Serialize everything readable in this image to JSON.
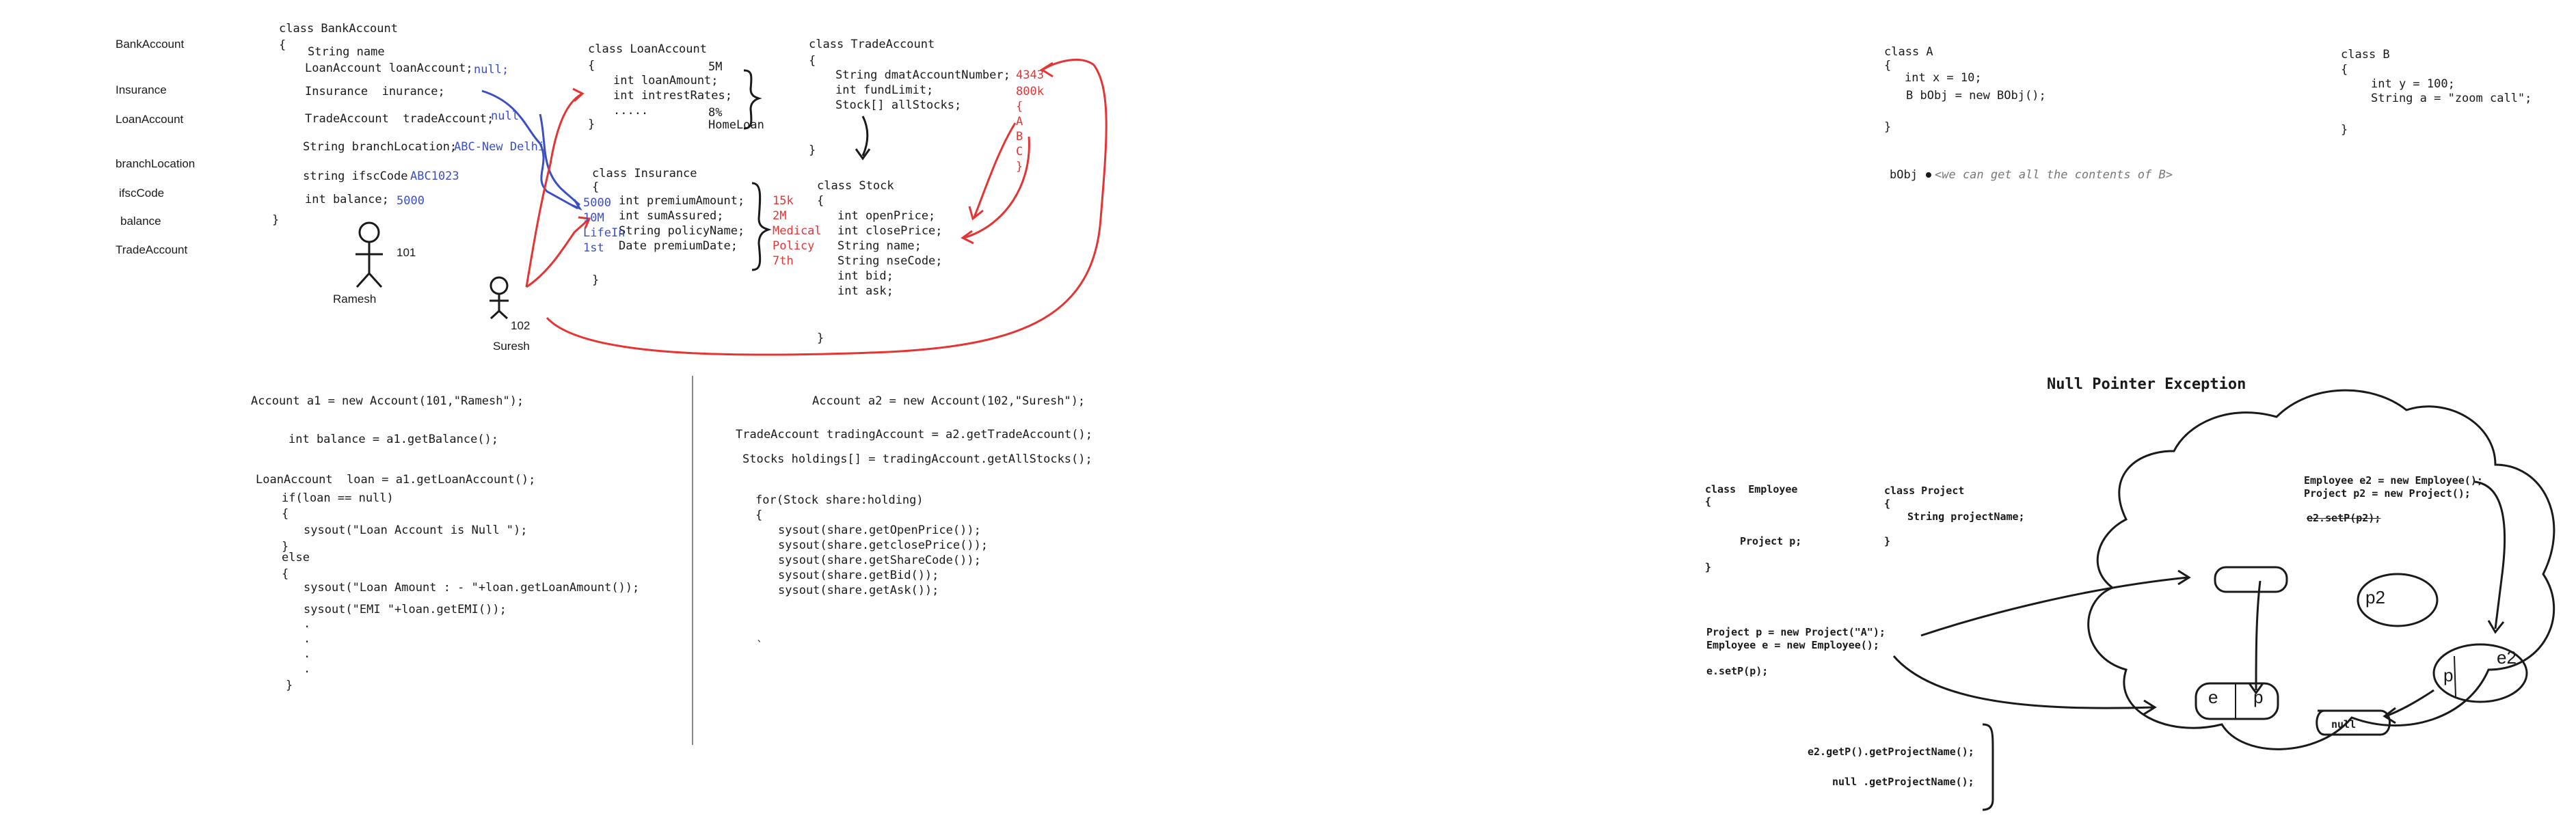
{
  "left_labels": [
    "BankAccount",
    "Insurance",
    "LoanAccount",
    "branchLocation",
    "ifscCode",
    "balance",
    "TradeAccount"
  ],
  "bank_account": {
    "header": "class BankAccount",
    "open_brace": "{",
    "lines": [
      "String name",
      "LoanAccount loanAccount;",
      "Insurance  inurance;",
      "TradeAccount  tradeAccount;",
      "String branchLocation;",
      "string ifscCode",
      "int balance;"
    ],
    "values": {
      "loan": "null;",
      "trade": "null",
      "branch": "ABC-New Delhi",
      "ifsc": "ABC1023",
      "balance": "5000"
    },
    "close_brace": "}"
  },
  "people": [
    {
      "name": "Ramesh",
      "id": "101"
    },
    {
      "name": "Suresh",
      "id": "102"
    }
  ],
  "loan_account": {
    "header": "class LoanAccount",
    "lines": [
      "{",
      "int loanAmount;",
      "int intrestRates;",
      ".....",
      "}"
    ],
    "annotations": [
      "5M",
      "8%",
      "HomeLoan"
    ]
  },
  "insurance": {
    "header": "class Insurance",
    "lines": [
      "{",
      "int premiumAmount;",
      "int sumAssured;",
      "String policyName;",
      "Date premiumDate;",
      "}"
    ],
    "left_values": [
      "5000",
      "10M",
      "LifeIn",
      "1st"
    ],
    "right_values": [
      "15k",
      "2M",
      "Medical",
      "Policy",
      "7th"
    ]
  },
  "trade_account": {
    "header": "class TradeAccount",
    "lines": [
      "{",
      "String dmatAccountNumber;",
      "int fundLimit;",
      "Stock[] allStocks;",
      "}"
    ],
    "values": [
      "4343",
      "800k",
      "{",
      "A",
      "B",
      "C",
      "}"
    ]
  },
  "stock": {
    "header": "class Stock",
    "lines": [
      "{",
      "int openPrice;",
      "int closePrice;",
      "String name;",
      "String nseCode;",
      "int bid;",
      "int ask;",
      "}"
    ]
  },
  "code_a1": [
    "Account a1 = new Account(101,\"Ramesh\");",
    "int balance = a1.getBalance();",
    "LoanAccount  loan = a1.getLoanAccount();",
    "if(loan == null)",
    "{",
    "sysout(\"Loan Account is Null \");",
    "}",
    "else",
    "{",
    "sysout(\"Loan Amount : - \"+loan.getLoanAmount());",
    "sysout(\"EMI \"+loan.getEMI());",
    ".",
    ".",
    ".",
    ".",
    "}"
  ],
  "code_a2": [
    "Account a2 = new Account(102,\"Suresh\");",
    "TradeAccount tradingAccount = a2.getTradeAccount();",
    "Stocks holdings[] = tradingAccount.getAllStocks();",
    "for(Stock share:holding)",
    "{",
    "sysout(share.getOpenPrice());",
    "sysout(share.getclosePrice());",
    "sysout(share.getShareCode());",
    "sysout(share.getBid());",
    "sysout(share.getAsk());",
    "`"
  ],
  "class_a": {
    "lines": [
      "class A",
      "{",
      "int x = 10;",
      "B bObj = new BObj();",
      "}"
    ]
  },
  "class_b": {
    "lines": [
      "class B",
      "{",
      "int y = 100;",
      "String a = \"zoom call\";",
      "}"
    ]
  },
  "bobj_note": {
    "label": "bObj",
    "comment": "<we can get all the contents of B>"
  },
  "npe": {
    "title": "Null Pointer Exception",
    "employee": [
      "class  Employee",
      "{",
      "Project p;",
      "}"
    ],
    "project": [
      "class Project",
      "{",
      "String projectName;",
      "}"
    ],
    "code_left": [
      "Project p = new Project(\"A\");",
      "Employee e = new Employee();",
      "e.setP(p);"
    ],
    "code_right": [
      "Employee e2 = new Employee();",
      "Project p2 = new Project();",
      "e2.setP(p2);"
    ],
    "calls": [
      "e2.getP().getProjectName();",
      "null .getProjectName();"
    ],
    "heap_labels": {
      "p2": "p2",
      "e": "e",
      "p": "p",
      "p_right": "p",
      "e2": "e2",
      "null": "null"
    }
  },
  "colors": {
    "ink": "#1a1a1a",
    "blue": "#3b4fc4",
    "red": "#e53434",
    "divider": "#888888"
  }
}
